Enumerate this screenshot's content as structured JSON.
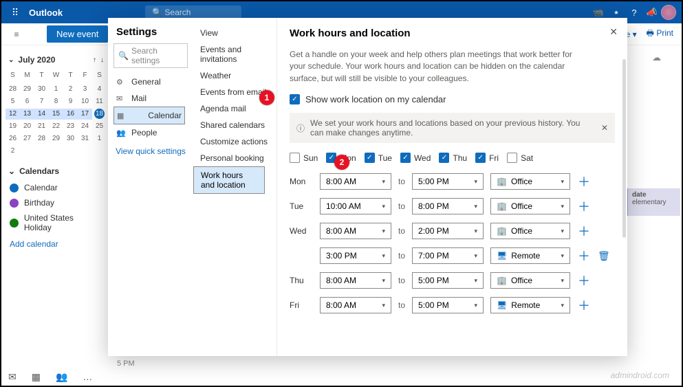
{
  "topbar": {
    "brand": "Outlook",
    "search": "Search"
  },
  "subbar": {
    "new_event": "New event",
    "share": "re ▾",
    "print": "🖶 Print"
  },
  "mini_calendar": {
    "month": "July 2020",
    "dow": [
      "S",
      "M",
      "T",
      "W",
      "T",
      "F",
      "S"
    ],
    "weeks": [
      [
        "28",
        "29",
        "30",
        "1",
        "2",
        "3",
        "4"
      ],
      [
        "5",
        "6",
        "7",
        "8",
        "9",
        "10",
        "11"
      ],
      [
        "12",
        "13",
        "14",
        "15",
        "16",
        "17",
        "18"
      ],
      [
        "19",
        "20",
        "21",
        "22",
        "23",
        "24",
        "25"
      ],
      [
        "26",
        "27",
        "28",
        "29",
        "30",
        "31",
        "1"
      ],
      [
        "2",
        "",
        "",
        "",
        "",
        "",
        ""
      ]
    ],
    "today": "18",
    "section": "Calendars",
    "items": [
      {
        "label": "Calendar",
        "color": "#0f6cbd"
      },
      {
        "label": "Birthday",
        "color": "#8b42c3"
      },
      {
        "label": "United States Holiday",
        "color": "#107c10"
      }
    ],
    "add": "Add calendar"
  },
  "bg": {
    "timestamp": "5 PM",
    "card_title": "date",
    "card_sub": "elementary"
  },
  "watermark": "admindroid.com",
  "modal": {
    "title": "Settings",
    "search_placeholder": "Search settings",
    "nav": [
      {
        "icon": "⚙",
        "label": "General"
      },
      {
        "icon": "✉",
        "label": "Mail"
      },
      {
        "icon": "▦",
        "label": "Calendar",
        "selected": true
      },
      {
        "icon": "👥",
        "label": "People"
      }
    ],
    "quick": "View quick settings",
    "sub": [
      "View",
      "Events and invitations",
      "Weather",
      "Events from email",
      "Agenda mail",
      "Shared calendars",
      "Customize actions",
      "Personal booking",
      "Work hours and location"
    ],
    "sub_selected": "Work hours and location",
    "panel": {
      "heading": "Work hours and location",
      "desc": "Get a handle on your week and help others plan meetings that work better for your schedule. Your work hours and location can be hidden on the calendar surface, but will still be visible to your colleagues.",
      "show_loc": "Show work location on my calendar",
      "banner": "We set your work hours and locations based on your previous history. You can make changes anytime.",
      "day_short": [
        "Sun",
        "Mon",
        "Tue",
        "Wed",
        "Thu",
        "Fri",
        "Sat"
      ],
      "day_checked": [
        false,
        true,
        true,
        true,
        true,
        true,
        false
      ],
      "rows": [
        {
          "label": "Mon",
          "start": "8:00 AM",
          "end": "5:00 PM",
          "loc": "Office",
          "loc_icon": "office"
        },
        {
          "label": "Tue",
          "start": "10:00 AM",
          "end": "8:00 PM",
          "loc": "Office",
          "loc_icon": "office"
        },
        {
          "label": "Wed",
          "start": "8:00 AM",
          "end": "2:00 PM",
          "loc": "Office",
          "loc_icon": "office"
        },
        {
          "label": "",
          "start": "3:00 PM",
          "end": "7:00 PM",
          "loc": "Remote",
          "loc_icon": "remote",
          "extra": true
        },
        {
          "label": "Thu",
          "start": "8:00 AM",
          "end": "5:00 PM",
          "loc": "Office",
          "loc_icon": "office"
        },
        {
          "label": "Fri",
          "start": "8:00 AM",
          "end": "5:00 PM",
          "loc": "Remote",
          "loc_icon": "remote"
        }
      ],
      "to": "to"
    }
  },
  "annotations": {
    "a1": "1",
    "a2": "2"
  }
}
